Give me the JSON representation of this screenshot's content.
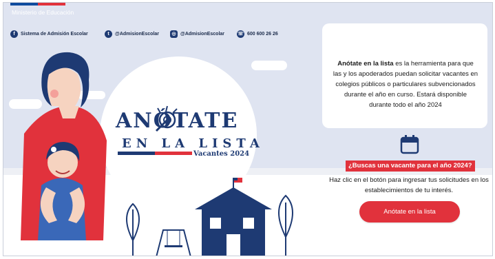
{
  "header": {
    "ministry_label": "Ministerio de Educación"
  },
  "social": [
    {
      "icon": "facebook-icon",
      "glyph": "f",
      "label": "Sistema de Admisión Escolar"
    },
    {
      "icon": "twitter-icon",
      "glyph": "t",
      "label": "@AdmisionEscolar"
    },
    {
      "icon": "instagram-icon",
      "glyph": "◎",
      "label": "@AdmisionEscolar"
    },
    {
      "icon": "phone-icon",
      "glyph": "☏",
      "label": "600 600 26 26"
    }
  ],
  "logo": {
    "line1": "ANÓTATE",
    "line2": "EN LA LISTA",
    "line3": "Vacantes 2024"
  },
  "card": {
    "bold": "Anótate en la lista",
    "text": " es la herramienta para que las y los apoderados puedan solicitar vacantes en colegios públicos o particulares subvencionados durante el año en curso. Estará disponible durante todo el año 2024"
  },
  "cta_section": {
    "question": "¿Buscas una vacante para el año 2024?",
    "help": "Haz clic en el botón para ingresar tus solicitudes en los establecimientos de tu interés.",
    "button_label": "Anótate en la lista"
  },
  "colors": {
    "background": "#dfe4f1",
    "navy": "#1e3a73",
    "red": "#e1323c"
  }
}
